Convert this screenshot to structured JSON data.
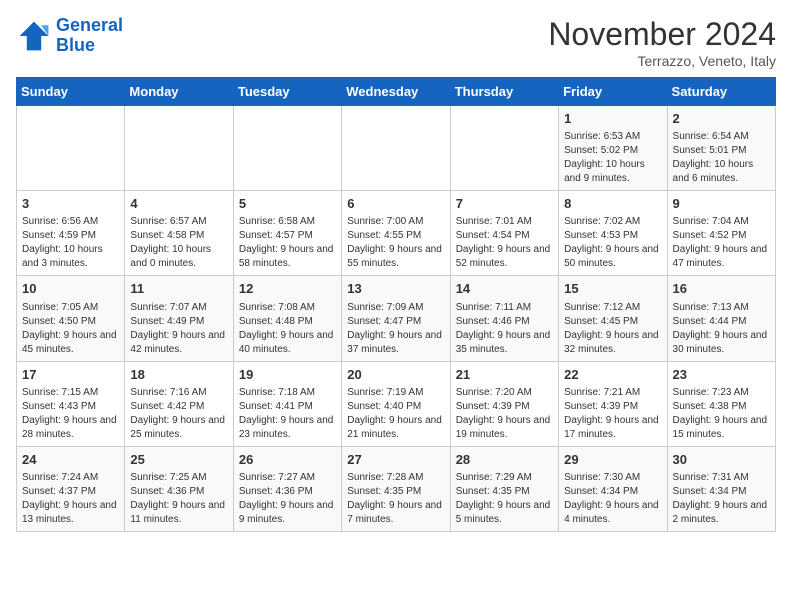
{
  "logo": {
    "line1": "General",
    "line2": "Blue"
  },
  "title": "November 2024",
  "subtitle": "Terrazzo, Veneto, Italy",
  "weekdays": [
    "Sunday",
    "Monday",
    "Tuesday",
    "Wednesday",
    "Thursday",
    "Friday",
    "Saturday"
  ],
  "weeks": [
    [
      {
        "day": "",
        "info": ""
      },
      {
        "day": "",
        "info": ""
      },
      {
        "day": "",
        "info": ""
      },
      {
        "day": "",
        "info": ""
      },
      {
        "day": "",
        "info": ""
      },
      {
        "day": "1",
        "info": "Sunrise: 6:53 AM\nSunset: 5:02 PM\nDaylight: 10 hours and 9 minutes."
      },
      {
        "day": "2",
        "info": "Sunrise: 6:54 AM\nSunset: 5:01 PM\nDaylight: 10 hours and 6 minutes."
      }
    ],
    [
      {
        "day": "3",
        "info": "Sunrise: 6:56 AM\nSunset: 4:59 PM\nDaylight: 10 hours and 3 minutes."
      },
      {
        "day": "4",
        "info": "Sunrise: 6:57 AM\nSunset: 4:58 PM\nDaylight: 10 hours and 0 minutes."
      },
      {
        "day": "5",
        "info": "Sunrise: 6:58 AM\nSunset: 4:57 PM\nDaylight: 9 hours and 58 minutes."
      },
      {
        "day": "6",
        "info": "Sunrise: 7:00 AM\nSunset: 4:55 PM\nDaylight: 9 hours and 55 minutes."
      },
      {
        "day": "7",
        "info": "Sunrise: 7:01 AM\nSunset: 4:54 PM\nDaylight: 9 hours and 52 minutes."
      },
      {
        "day": "8",
        "info": "Sunrise: 7:02 AM\nSunset: 4:53 PM\nDaylight: 9 hours and 50 minutes."
      },
      {
        "day": "9",
        "info": "Sunrise: 7:04 AM\nSunset: 4:52 PM\nDaylight: 9 hours and 47 minutes."
      }
    ],
    [
      {
        "day": "10",
        "info": "Sunrise: 7:05 AM\nSunset: 4:50 PM\nDaylight: 9 hours and 45 minutes."
      },
      {
        "day": "11",
        "info": "Sunrise: 7:07 AM\nSunset: 4:49 PM\nDaylight: 9 hours and 42 minutes."
      },
      {
        "day": "12",
        "info": "Sunrise: 7:08 AM\nSunset: 4:48 PM\nDaylight: 9 hours and 40 minutes."
      },
      {
        "day": "13",
        "info": "Sunrise: 7:09 AM\nSunset: 4:47 PM\nDaylight: 9 hours and 37 minutes."
      },
      {
        "day": "14",
        "info": "Sunrise: 7:11 AM\nSunset: 4:46 PM\nDaylight: 9 hours and 35 minutes."
      },
      {
        "day": "15",
        "info": "Sunrise: 7:12 AM\nSunset: 4:45 PM\nDaylight: 9 hours and 32 minutes."
      },
      {
        "day": "16",
        "info": "Sunrise: 7:13 AM\nSunset: 4:44 PM\nDaylight: 9 hours and 30 minutes."
      }
    ],
    [
      {
        "day": "17",
        "info": "Sunrise: 7:15 AM\nSunset: 4:43 PM\nDaylight: 9 hours and 28 minutes."
      },
      {
        "day": "18",
        "info": "Sunrise: 7:16 AM\nSunset: 4:42 PM\nDaylight: 9 hours and 25 minutes."
      },
      {
        "day": "19",
        "info": "Sunrise: 7:18 AM\nSunset: 4:41 PM\nDaylight: 9 hours and 23 minutes."
      },
      {
        "day": "20",
        "info": "Sunrise: 7:19 AM\nSunset: 4:40 PM\nDaylight: 9 hours and 21 minutes."
      },
      {
        "day": "21",
        "info": "Sunrise: 7:20 AM\nSunset: 4:39 PM\nDaylight: 9 hours and 19 minutes."
      },
      {
        "day": "22",
        "info": "Sunrise: 7:21 AM\nSunset: 4:39 PM\nDaylight: 9 hours and 17 minutes."
      },
      {
        "day": "23",
        "info": "Sunrise: 7:23 AM\nSunset: 4:38 PM\nDaylight: 9 hours and 15 minutes."
      }
    ],
    [
      {
        "day": "24",
        "info": "Sunrise: 7:24 AM\nSunset: 4:37 PM\nDaylight: 9 hours and 13 minutes."
      },
      {
        "day": "25",
        "info": "Sunrise: 7:25 AM\nSunset: 4:36 PM\nDaylight: 9 hours and 11 minutes."
      },
      {
        "day": "26",
        "info": "Sunrise: 7:27 AM\nSunset: 4:36 PM\nDaylight: 9 hours and 9 minutes."
      },
      {
        "day": "27",
        "info": "Sunrise: 7:28 AM\nSunset: 4:35 PM\nDaylight: 9 hours and 7 minutes."
      },
      {
        "day": "28",
        "info": "Sunrise: 7:29 AM\nSunset: 4:35 PM\nDaylight: 9 hours and 5 minutes."
      },
      {
        "day": "29",
        "info": "Sunrise: 7:30 AM\nSunset: 4:34 PM\nDaylight: 9 hours and 4 minutes."
      },
      {
        "day": "30",
        "info": "Sunrise: 7:31 AM\nSunset: 4:34 PM\nDaylight: 9 hours and 2 minutes."
      }
    ]
  ]
}
